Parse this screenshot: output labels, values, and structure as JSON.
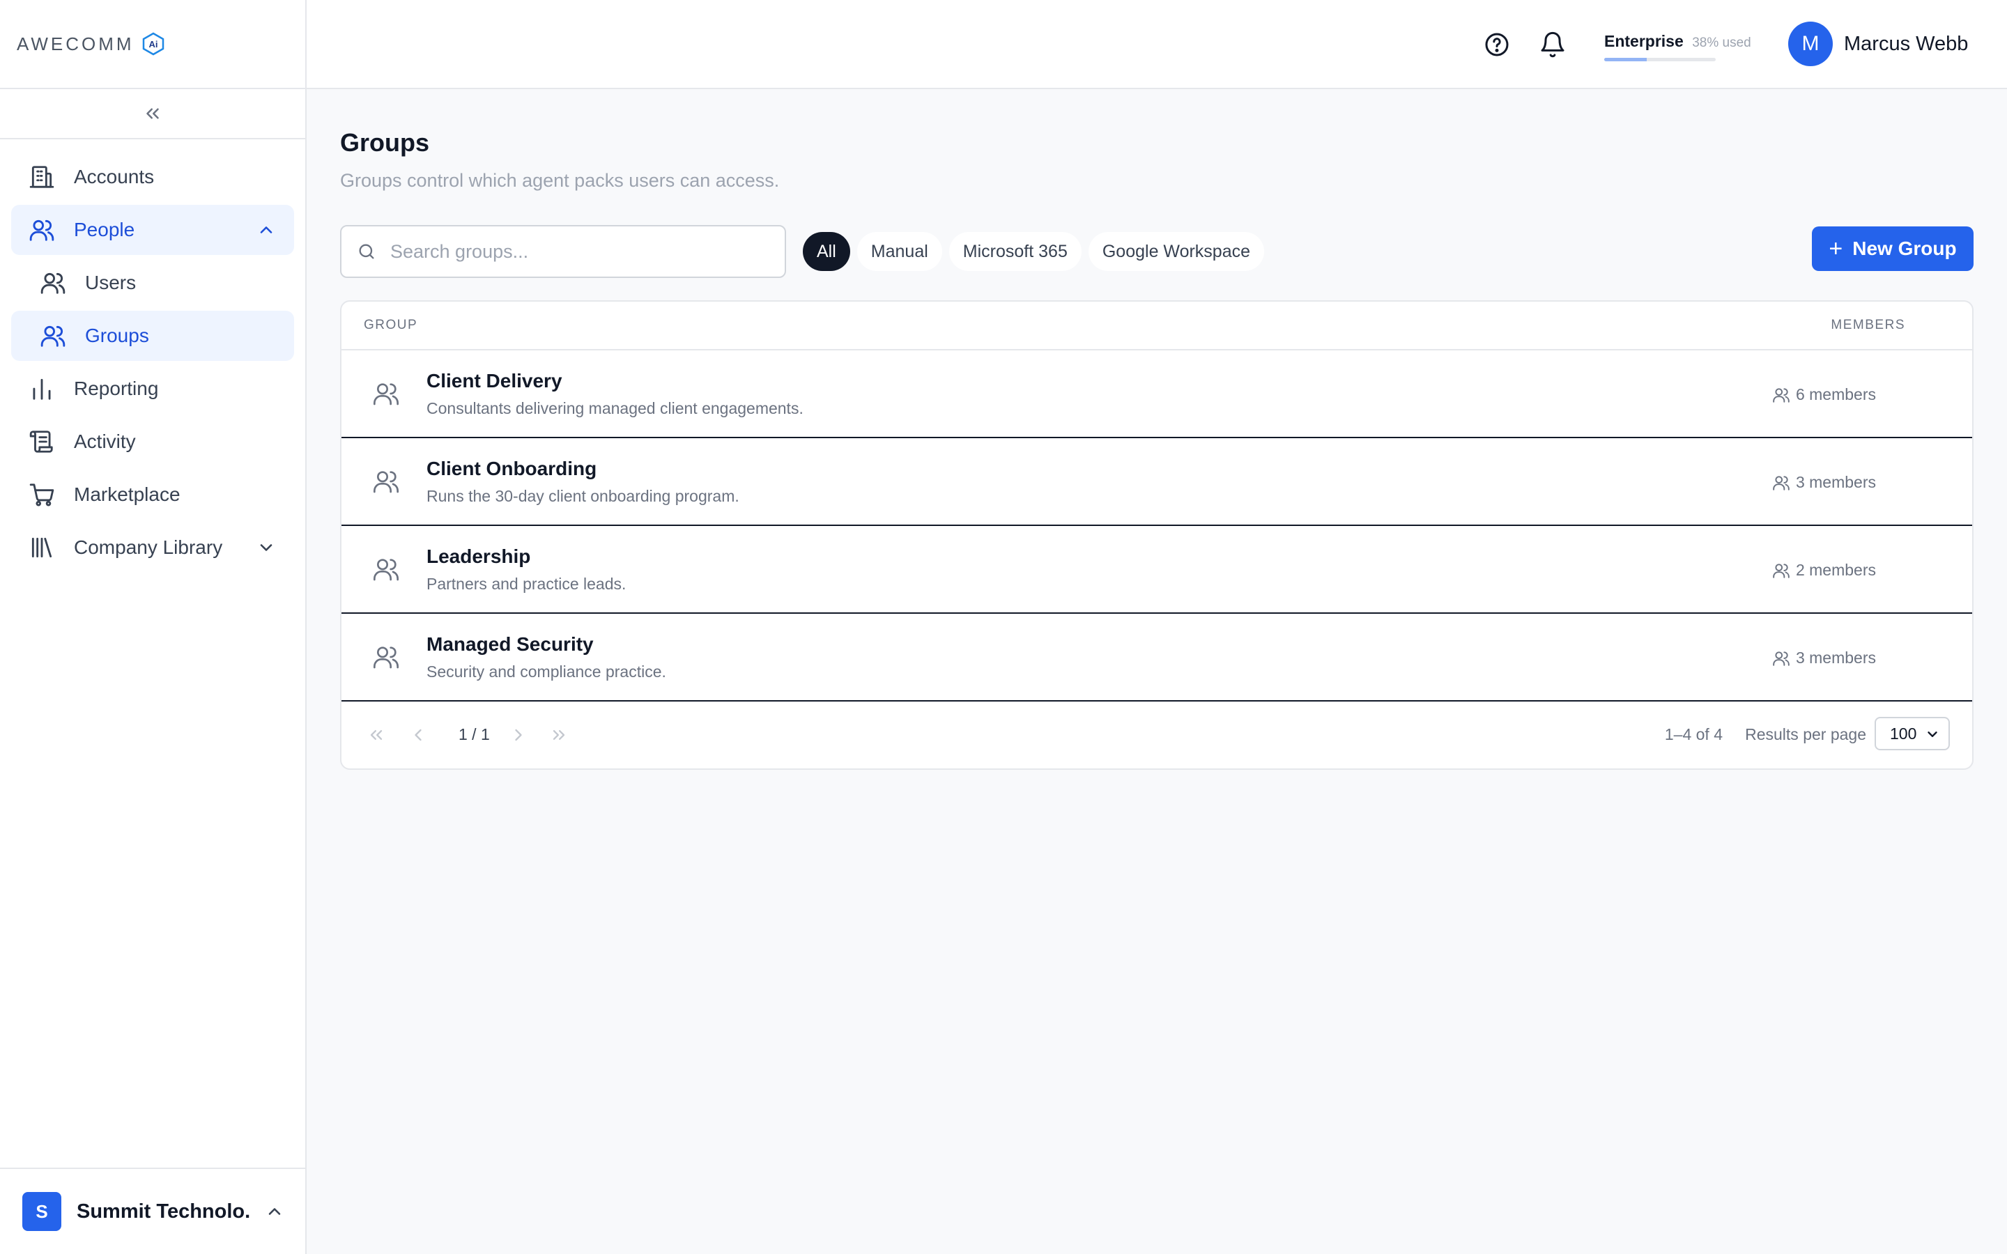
{
  "brand": {
    "name": "AWECOMM",
    "badge": "Ai"
  },
  "sidebar": {
    "items": [
      {
        "label": "Accounts"
      },
      {
        "label": "People"
      },
      {
        "label": "Users"
      },
      {
        "label": "Groups"
      },
      {
        "label": "Reporting"
      },
      {
        "label": "Activity"
      },
      {
        "label": "Marketplace"
      },
      {
        "label": "Company Library"
      }
    ],
    "org": {
      "initial": "S",
      "name": "Summit Technolo..."
    }
  },
  "topbar": {
    "plan": {
      "name": "Enterprise",
      "used": "38% used",
      "used_fraction": 0.38
    },
    "user": {
      "initial": "M",
      "name": "Marcus Webb"
    }
  },
  "page": {
    "title": "Groups",
    "subtitle": "Groups control which agent packs users can access."
  },
  "toolbar": {
    "search_placeholder": "Search groups...",
    "filters": [
      "All",
      "Manual",
      "Microsoft 365",
      "Google Workspace"
    ],
    "active_filter": "All",
    "new_label": "New Group"
  },
  "table": {
    "headers": {
      "group": "GROUP",
      "members": "MEMBERS"
    },
    "rows": [
      {
        "name": "Client Delivery",
        "desc": "Consultants delivering managed client engagements.",
        "members": "6 members"
      },
      {
        "name": "Client Onboarding",
        "desc": "Runs the 30-day client onboarding program.",
        "members": "3 members"
      },
      {
        "name": "Leadership",
        "desc": "Partners and practice leads.",
        "members": "2 members"
      },
      {
        "name": "Managed Security",
        "desc": "Security and compliance practice.",
        "members": "3 members"
      }
    ]
  },
  "pagination": {
    "page": "1 / 1",
    "range": "1–4 of 4",
    "per_page_label": "Results per page",
    "per_page_value": "100"
  },
  "colors": {
    "accent": "#2563eb",
    "active_bg": "#eef4ff",
    "active_text": "#1d4ed8"
  }
}
